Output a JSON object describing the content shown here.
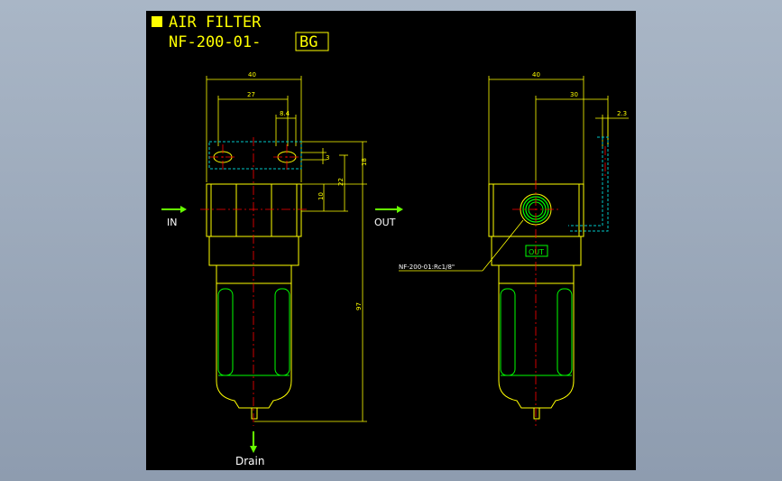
{
  "title": {
    "line1": "AIR FILTER",
    "model_prefix": "NF-200-01-",
    "model_suffix": "BG"
  },
  "ports": {
    "in_label": "IN",
    "out_label": "OUT",
    "drain_label": "Drain",
    "out_badge": "OUT"
  },
  "callout": {
    "port_spec": "NF-200-01:Rc1/8\""
  },
  "dimensions": {
    "front_width": "40",
    "bracket_span": "27",
    "hole_pitch": "8.4",
    "small_offset": "3",
    "bracket_height": "18",
    "port_offset_22": "22",
    "port_offset_10": "10",
    "overall_height": "97",
    "side_width": "40",
    "side_offset": "30",
    "bracket_thickness": "2.3"
  },
  "colors": {
    "background": "#000000",
    "outline": "#ffff00",
    "centerline": "#ff0000",
    "hidden": "#00c8c8",
    "bowl": "#00ff00",
    "arrow": "#66ff00",
    "text": "#ffffff"
  }
}
